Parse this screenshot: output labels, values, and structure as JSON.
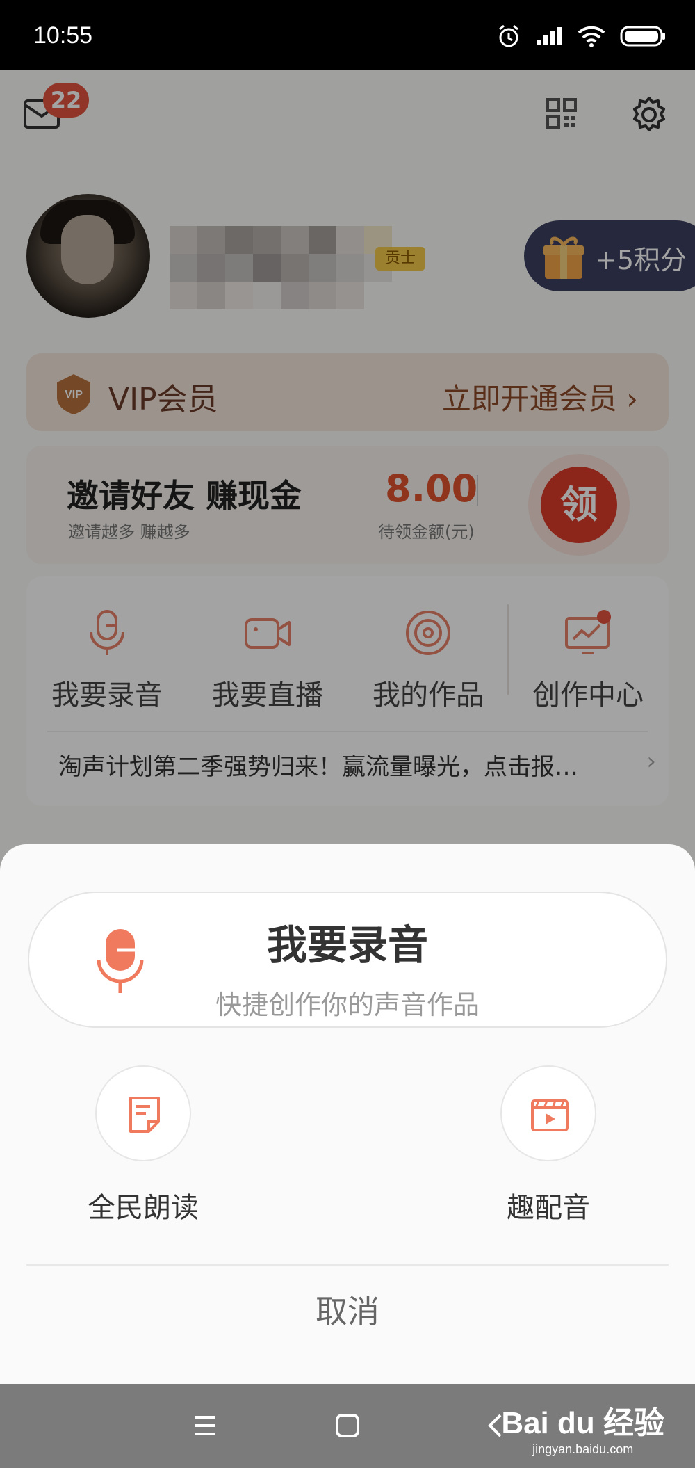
{
  "status_bar": {
    "time": "10:55"
  },
  "header": {
    "unread_badge": "22"
  },
  "profile": {
    "rank_badge": "贡士",
    "points_reward": "+5积分"
  },
  "vip": {
    "title": "VIP会员",
    "action": "立即开通会员 ›"
  },
  "invite": {
    "title": "邀请好友  赚现金",
    "subtitle": "邀请越多 赚越多",
    "amount": "8.00",
    "amount_label": "待领金额(元)",
    "claim_label": "领"
  },
  "tools": {
    "items": [
      {
        "label": "我要录音",
        "icon": "microphone-icon"
      },
      {
        "label": "我要直播",
        "icon": "video-camera-icon"
      },
      {
        "label": "我的作品",
        "icon": "disc-icon"
      },
      {
        "label": "创作中心",
        "icon": "creator-center-icon"
      }
    ],
    "promo": "淘声计划第二季强势归来！赢流量曝光，点击报…"
  },
  "sheet": {
    "primary_title": "我要录音",
    "primary_subtitle": "快捷创作你的声音作品",
    "options": [
      {
        "label": "全民朗读",
        "icon": "document-icon"
      },
      {
        "label": "趣配音",
        "icon": "film-play-icon"
      }
    ],
    "cancel": "取消"
  },
  "watermark": {
    "logo": "Bai du 经验",
    "url": "jingyan.baidu.com"
  },
  "colors": {
    "accent": "#f07a5e",
    "badge": "#e2533e",
    "sheet_bg": "#fafafa"
  }
}
